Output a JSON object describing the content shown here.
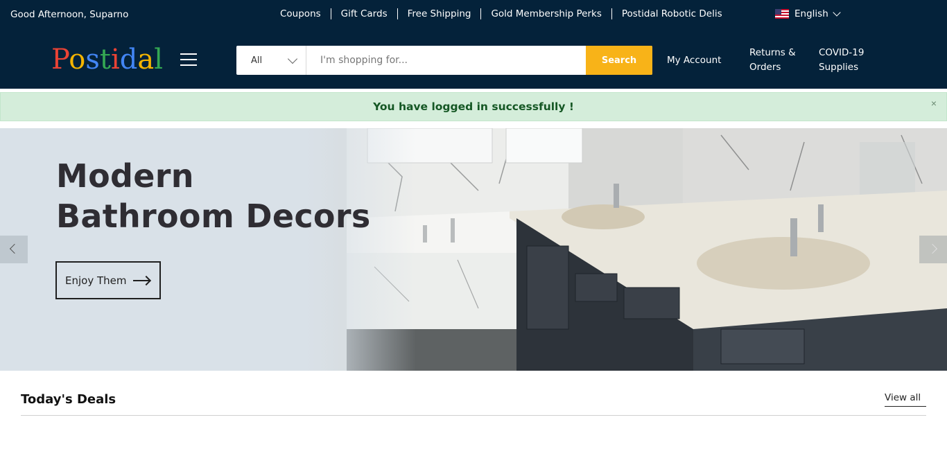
{
  "topbar": {
    "greeting": "Good Afternoon, Suparno",
    "links": [
      "Coupons",
      "Gift Cards",
      "Free Shipping",
      "Gold Membership Perks",
      "Postidal Robotic Delis"
    ],
    "language": "English",
    "flag_icon": "us-flag-icon"
  },
  "header": {
    "logo_letters": [
      {
        "ch": "P",
        "color": "#ea4335"
      },
      {
        "ch": "o",
        "color": "#f4b400"
      },
      {
        "ch": "s",
        "color": "#4285f4"
      },
      {
        "ch": "t",
        "color": "#34a853"
      },
      {
        "ch": "i",
        "color": "#ea4335"
      },
      {
        "ch": "d",
        "color": "#4285f4"
      },
      {
        "ch": "a",
        "color": "#f4b400"
      },
      {
        "ch": "l",
        "color": "#34a853"
      }
    ],
    "menu_icon": "hamburger-menu-icon",
    "search": {
      "category": "All",
      "placeholder": "I'm shopping for...",
      "value": "",
      "button": "Search"
    },
    "my_account": "My Account",
    "returns_line1": "Returns &",
    "returns_line2": "Orders",
    "covid_line1": "COVID-19",
    "covid_line2": "Supplies"
  },
  "alert": {
    "message": "You have logged in successfully !",
    "close": "×"
  },
  "banner": {
    "title_line1": "Modern",
    "title_line2": "Bathroom Decors",
    "button": "Enjoy Them",
    "prev_icon": "chevron-left-icon",
    "next_icon": "chevron-right-icon"
  },
  "deals": {
    "title": "Today's Deals",
    "view_all": "View all"
  },
  "colors": {
    "navy": "#04223a",
    "search_button": "#f8b318",
    "alert_bg": "#d4edda",
    "alert_text": "#155724"
  }
}
